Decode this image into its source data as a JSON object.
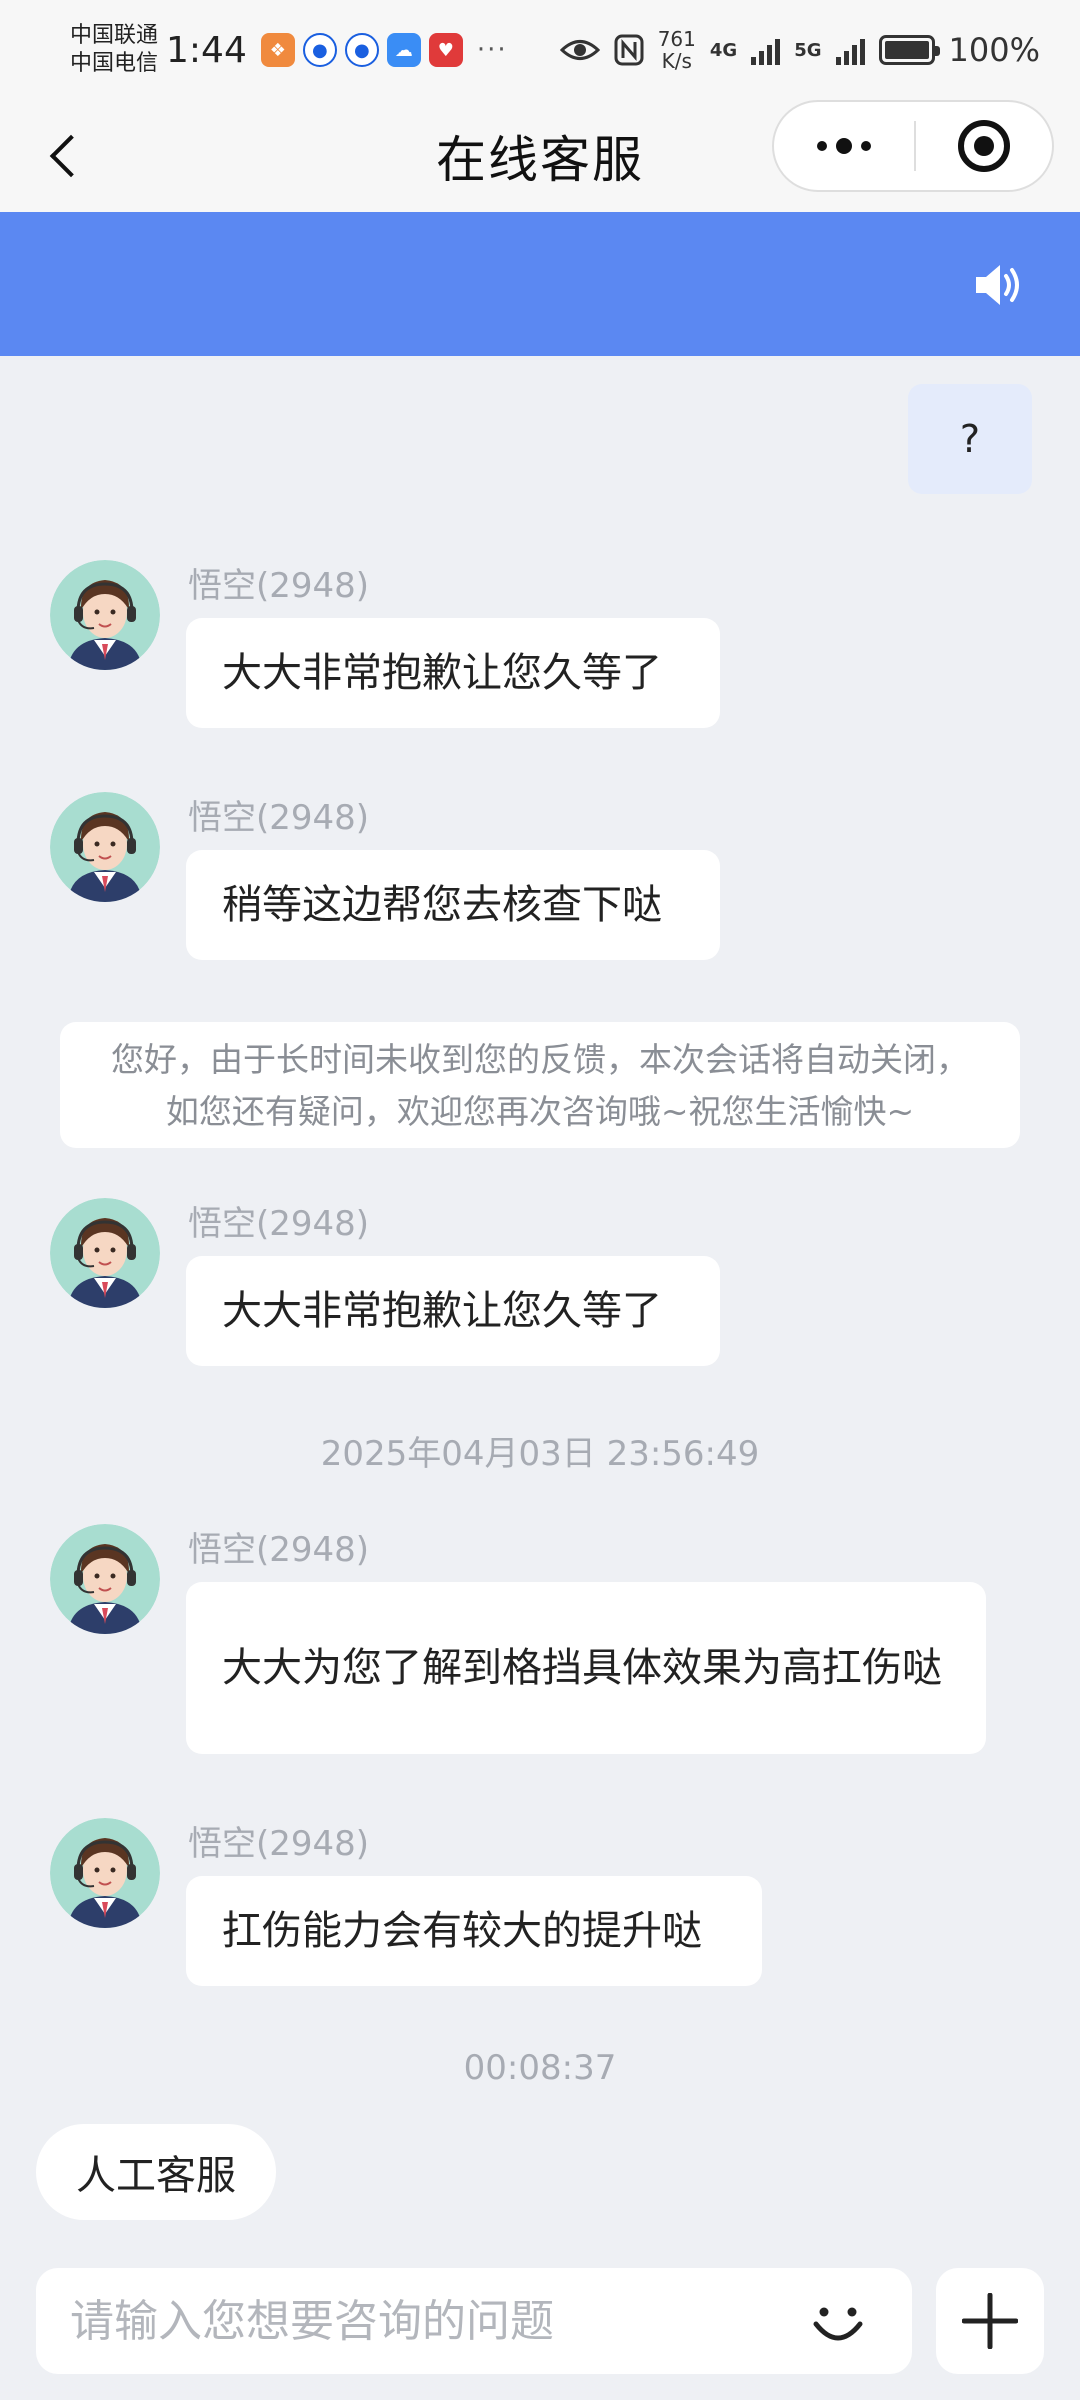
{
  "status_bar": {
    "carrier_1": "中国联通",
    "carrier_2": "中国电信",
    "time": "1:44",
    "app_icons": [
      {
        "name": "wallet-app-icon",
        "color": "#f08a3e"
      },
      {
        "name": "blue-app-icon-1",
        "color": "#1a5fe0"
      },
      {
        "name": "blue-app-icon-2",
        "color": "#1a5fe0"
      },
      {
        "name": "cloud-app-icon",
        "color": "#3a8df5"
      },
      {
        "name": "red-app-icon",
        "color": "#e03a3a"
      }
    ],
    "more": "···",
    "speed_value": "761",
    "speed_unit": "K/s",
    "net_1": "4G",
    "net_2": "5G",
    "battery_level": 100,
    "battery_text": "100%"
  },
  "nav": {
    "title": "在线客服"
  },
  "banner": {
    "color": "#5b88f2",
    "icon": "speaker-icon"
  },
  "chat": {
    "user_message": "?",
    "agent_name": "悟空(2948)",
    "messages": [
      "大大非常抱歉让您久等了",
      "稍等这边帮您去核查下哒",
      "大大非常抱歉让您久等了",
      "大大为您了解到格挡具体效果为高扛伤哒",
      "扛伤能力会有较大的提升哒"
    ],
    "system_note": "您好，由于长时间未收到您的反馈，本次会话将自动关闭，如您还有疑问，欢迎您再次咨询哦~祝您生活愉快~",
    "timestamps": [
      "2025年04月03日 23:56:49",
      "00:08:37"
    ]
  },
  "footer": {
    "quick_reply": "人工客服",
    "input_placeholder": "请输入您想要咨询的问题",
    "input_value": ""
  }
}
